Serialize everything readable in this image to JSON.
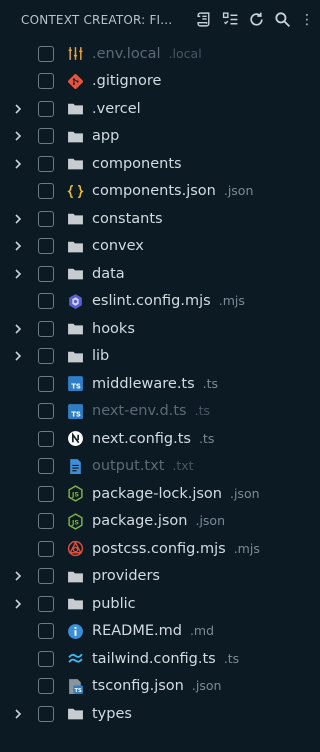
{
  "header": {
    "title": "CONTEXT CREATOR: FI...",
    "more": "⋮"
  },
  "tree": [
    {
      "name": ".env.local",
      "desc": ".local",
      "type": "file",
      "icon": "settings-sliders-icon",
      "dim": true
    },
    {
      "name": ".gitignore",
      "desc": "",
      "type": "file",
      "icon": "git-icon",
      "dim": false
    },
    {
      "name": ".vercel",
      "desc": "",
      "type": "folder",
      "icon": "folder-icon",
      "dim": false
    },
    {
      "name": "app",
      "desc": "",
      "type": "folder",
      "icon": "folder-icon",
      "dim": false
    },
    {
      "name": "components",
      "desc": "",
      "type": "folder",
      "icon": "folder-icon",
      "dim": false
    },
    {
      "name": "components.json",
      "desc": ".json",
      "type": "file",
      "icon": "json-braces-icon",
      "dim": false
    },
    {
      "name": "constants",
      "desc": "",
      "type": "folder",
      "icon": "folder-icon",
      "dim": false
    },
    {
      "name": "convex",
      "desc": "",
      "type": "folder",
      "icon": "folder-icon",
      "dim": false
    },
    {
      "name": "data",
      "desc": "",
      "type": "folder",
      "icon": "folder-icon",
      "dim": false
    },
    {
      "name": "eslint.config.mjs",
      "desc": ".mjs",
      "type": "file",
      "icon": "eslint-icon",
      "dim": false
    },
    {
      "name": "hooks",
      "desc": "",
      "type": "folder",
      "icon": "folder-icon",
      "dim": false
    },
    {
      "name": "lib",
      "desc": "",
      "type": "folder",
      "icon": "folder-icon",
      "dim": false
    },
    {
      "name": "middleware.ts",
      "desc": ".ts",
      "type": "file",
      "icon": "typescript-icon",
      "dim": false
    },
    {
      "name": "next-env.d.ts",
      "desc": ".ts",
      "type": "file",
      "icon": "typescript-icon",
      "dim": true
    },
    {
      "name": "next.config.ts",
      "desc": ".ts",
      "type": "file",
      "icon": "nextjs-icon",
      "dim": false
    },
    {
      "name": "output.txt",
      "desc": ".txt",
      "type": "file",
      "icon": "text-file-icon",
      "dim": true
    },
    {
      "name": "package-lock.json",
      "desc": ".json",
      "type": "file",
      "icon": "nodejs-icon",
      "dim": false
    },
    {
      "name": "package.json",
      "desc": ".json",
      "type": "file",
      "icon": "nodejs-icon",
      "dim": false
    },
    {
      "name": "postcss.config.mjs",
      "desc": ".mjs",
      "type": "file",
      "icon": "postcss-icon",
      "dim": false
    },
    {
      "name": "providers",
      "desc": "",
      "type": "folder",
      "icon": "folder-icon",
      "dim": false
    },
    {
      "name": "public",
      "desc": "",
      "type": "folder",
      "icon": "folder-icon",
      "dim": false
    },
    {
      "name": "README.md",
      "desc": ".md",
      "type": "file",
      "icon": "info-icon",
      "dim": false
    },
    {
      "name": "tailwind.config.ts",
      "desc": ".ts",
      "type": "file",
      "icon": "tailwind-icon",
      "dim": false
    },
    {
      "name": "tsconfig.json",
      "desc": ".json",
      "type": "file",
      "icon": "tsconfig-icon",
      "dim": false
    },
    {
      "name": "types",
      "desc": "",
      "type": "folder",
      "icon": "folder-icon",
      "dim": false
    }
  ]
}
